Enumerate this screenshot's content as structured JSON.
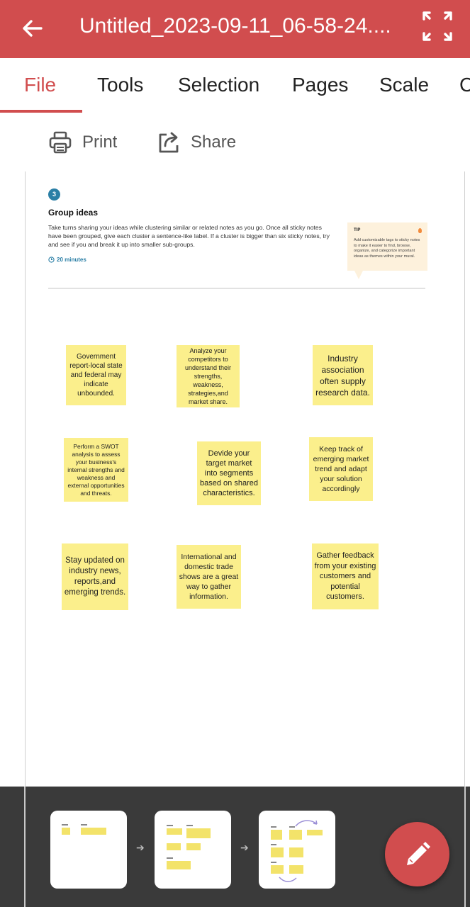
{
  "header": {
    "title": "Untitled_2023-09-11_06-58-24...."
  },
  "tabs": [
    {
      "label": "File"
    },
    {
      "label": "Tools"
    },
    {
      "label": "Selection"
    },
    {
      "label": "Pages"
    },
    {
      "label": "Scale"
    },
    {
      "label": "C"
    }
  ],
  "actions": {
    "print_label": "Print",
    "share_label": "Share"
  },
  "section": {
    "step_number": "3",
    "title": "Group ideas",
    "description": "Take turns sharing your ideas while clustering similar or related notes as you go. Once all sticky notes have been grouped, give each cluster a sentence-like label. If a cluster is bigger than six sticky notes, try and see if you and break it up into smaller sub-groups.",
    "timer": "20 minutes"
  },
  "tip": {
    "label": "TIP",
    "text": "Add customizable tags to sticky notes to make it easier to find, browse, organize, and categorize important ideas as themes within your mural."
  },
  "stickies": [
    {
      "text": "Government report-local state and federal may indicate unbounded."
    },
    {
      "text": "Analyze your competitors to understand their strengths, weakness, strategies,and market share."
    },
    {
      "text": "Industry association often supply research data."
    },
    {
      "text": "Perform a SWOT analysis to assess your business's internal strengths and weakness and external opportunities and threats."
    },
    {
      "text": "Devide your target market into segments based on shared characteristics."
    },
    {
      "text": "Keep track of emerging market trend and adapt your solution accordingly"
    },
    {
      "text": "Stay updated on industry news, reports,and emerging trends."
    },
    {
      "text": "International and domestic trade shows are a great way to gather information."
    },
    {
      "text": "Gather feedback from your existing customers and potential customers."
    }
  ],
  "colors": {
    "accent": "#d14d4e",
    "sticky": "#fbef8c",
    "tip_bg": "#fdf1dc",
    "badge": "#2b7fa6",
    "bottom_bar": "#3a3a3a"
  },
  "icons": [
    "back-arrow-icon",
    "expand-icon",
    "print-icon",
    "share-icon",
    "clock-icon",
    "lightbulb-icon",
    "pencil-icon",
    "chevron-right-icon"
  ]
}
